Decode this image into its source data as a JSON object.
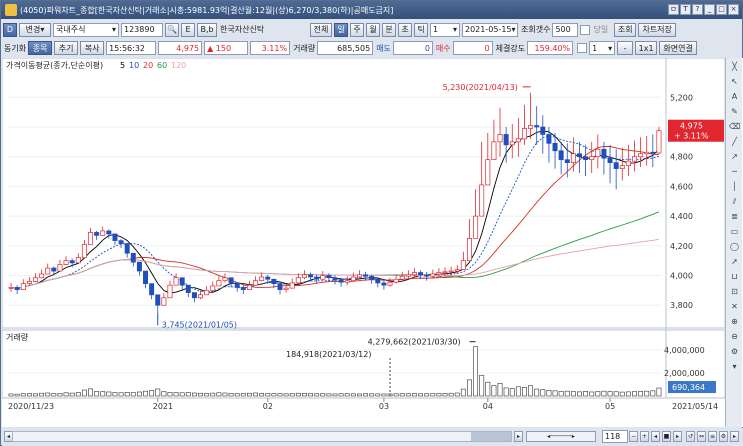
{
  "window": {
    "title": "(4050)파워차트_종합[한국자산신탁|거래소|시총:5981.93억|결산월:12월|(상)6,270/3,380(하)|공매도금지]",
    "controls": [
      "ㅁ",
      "T",
      "?",
      "_",
      "□",
      "×"
    ]
  },
  "toolbar1": {
    "left_btn": "D",
    "change_label": "변경",
    "market_select": "국내주식",
    "stock_code": "123890",
    "btn_e": "E",
    "btn_bb": "B,b",
    "stock_name": "한국자산신탁",
    "btn_all": "전체",
    "period_tabs": [
      "일",
      "주",
      "월",
      "분",
      "초",
      "틱"
    ],
    "period_count": "1",
    "date": "2021-05-15",
    "view_count_label": "조회갯수",
    "view_count": "500",
    "same_day_label": "당일",
    "query_btn": "조회",
    "save_btn": "차트저장"
  },
  "toolbar2": {
    "sync_label": "동기화",
    "item_tabs": [
      "종목",
      "추기",
      "복사"
    ],
    "time": "15:56:32",
    "price": "4,975",
    "change": "▲ 150",
    "change_pct": "3.11%",
    "volume_label": "거래량",
    "volume": "685,505",
    "sell_label": "매도",
    "sell": "0",
    "buy_label": "매수",
    "buy": "0",
    "strength_label": "체결강도",
    "strength": "159.40%",
    "sel_value": "1",
    "btn_1x1": "1x1",
    "screen_link": "화면연결"
  },
  "chart_data": [
    {
      "type": "candlestick",
      "title": "가격이동평균(종가,단순이평)",
      "ma_periods": [
        "5",
        "10",
        "20",
        "60",
        "120"
      ],
      "ma_colors": [
        "#000000",
        "#1f4fbf",
        "#d83020",
        "#2a9a4a",
        "#e8a0b0"
      ],
      "y_ticks": [
        "5,200",
        "5,000",
        "4,800",
        "4,600",
        "4,400",
        "4,200",
        "4,000",
        "3,800"
      ],
      "y_range": [
        3660,
        5330
      ],
      "high_label": "5,230(2021/04/13)",
      "low_label": "3,745(2021/01/05)",
      "current_price": "4,975",
      "current_change": "+ 3.11%",
      "closes": [
        3920,
        3905,
        3945,
        3960,
        3985,
        4010,
        4050,
        4030,
        4075,
        4100,
        4085,
        4120,
        4210,
        4290,
        4270,
        4300,
        4280,
        4235,
        4215,
        4150,
        4090,
        4030,
        3945,
        3870,
        3800,
        3850,
        3935,
        3985,
        3935,
        3885,
        3850,
        3870,
        3900,
        3930,
        3965,
        3985,
        3950,
        3920,
        3905,
        3935,
        3965,
        3990,
        3975,
        3945,
        3905,
        3915,
        3950,
        3985,
        4005,
        3990,
        3975,
        4000,
        3985,
        3970,
        3955,
        3965,
        3990,
        4005,
        3995,
        3975,
        3950,
        3935,
        3955,
        3975,
        3995,
        4005,
        4020,
        4005,
        3995,
        4010,
        4020,
        4025,
        4030,
        4040,
        4100,
        4250,
        4400,
        4610,
        4780,
        4900,
        4950,
        4880,
        4900,
        4920,
        4990,
        5010,
        5000,
        4950,
        4890,
        4840,
        4780,
        4760,
        4820,
        4800,
        4780,
        4800,
        4850,
        4790,
        4760,
        4720,
        4740,
        4770,
        4800,
        4820,
        4830,
        4825,
        4975
      ],
      "highs": [
        3950,
        3935,
        3975,
        3990,
        4015,
        4040,
        4080,
        4060,
        4105,
        4130,
        4115,
        4150,
        4240,
        4320,
        4300,
        4330,
        4310,
        4265,
        4245,
        4180,
        4120,
        4060,
        3975,
        3900,
        3830,
        3880,
        3965,
        4015,
        3965,
        3915,
        3880,
        3900,
        3930,
        3960,
        3995,
        4015,
        3980,
        3950,
        3935,
        3965,
        3995,
        4020,
        4005,
        3975,
        3935,
        3945,
        3980,
        4015,
        4035,
        4020,
        4005,
        4030,
        4015,
        4000,
        3985,
        3995,
        4020,
        4035,
        4025,
        4005,
        3980,
        3965,
        3985,
        4005,
        4025,
        4035,
        4050,
        4035,
        4025,
        4040,
        4050,
        4055,
        4060,
        4070,
        4160,
        4380,
        4580,
        4900,
        4960,
        5050,
        5130,
        5000,
        5020,
        5060,
        5150,
        5230,
        5140,
        5080,
        5000,
        4960,
        4900,
        4890,
        4930,
        4900,
        4880,
        4900,
        4950,
        4900,
        4880,
        4850,
        4860,
        4880,
        4910,
        4930,
        4940,
        4950,
        5000
      ],
      "lows": [
        3890,
        3875,
        3915,
        3930,
        3955,
        3980,
        4020,
        4000,
        4045,
        4070,
        4055,
        4090,
        4180,
        4260,
        4240,
        4270,
        4250,
        4205,
        4185,
        4120,
        4060,
        4000,
        3915,
        3840,
        3745,
        3820,
        3905,
        3955,
        3905,
        3855,
        3820,
        3840,
        3870,
        3900,
        3935,
        3955,
        3920,
        3890,
        3875,
        3905,
        3935,
        3960,
        3945,
        3915,
        3875,
        3885,
        3920,
        3955,
        3975,
        3960,
        3945,
        3970,
        3955,
        3940,
        3925,
        3935,
        3960,
        3975,
        3965,
        3945,
        3920,
        3905,
        3925,
        3945,
        3965,
        3975,
        3990,
        3975,
        3965,
        3980,
        3990,
        3995,
        4000,
        4010,
        4040,
        4120,
        4300,
        4450,
        4620,
        4780,
        4800,
        4760,
        4790,
        4800,
        4880,
        4920,
        4880,
        4820,
        4760,
        4720,
        4680,
        4660,
        4700,
        4690,
        4670,
        4690,
        4720,
        4680,
        4620,
        4580,
        4640,
        4670,
        4700,
        4730,
        4740,
        4730,
        4820
      ]
    },
    {
      "type": "bar",
      "title": "거래량",
      "y_ticks": [
        "4,000,000",
        "2,000,000"
      ],
      "y_range": [
        0,
        4600000
      ],
      "peak_label": "4,279,662(2021/03/30)",
      "marker_label": "184,918(2021/03/12)",
      "current_volume": "690,364",
      "values": [
        180000,
        160000,
        200000,
        220000,
        190000,
        240000,
        260000,
        210000,
        230000,
        280000,
        250000,
        300000,
        520000,
        620000,
        400000,
        380000,
        350000,
        300000,
        280000,
        320000,
        300000,
        350000,
        420000,
        480000,
        610000,
        380000,
        320000,
        290000,
        280000,
        300000,
        260000,
        240000,
        220000,
        250000,
        280000,
        260000,
        230000,
        210000,
        220000,
        240000,
        260000,
        230000,
        220000,
        200000,
        210000,
        190000,
        220000,
        240000,
        230000,
        210000,
        200000,
        220000,
        190000,
        180000,
        200000,
        210000,
        190000,
        180000,
        200000,
        195000,
        185000,
        175000,
        184918,
        190000,
        200000,
        210000,
        205000,
        195000,
        200000,
        210000,
        220000,
        230000,
        240000,
        260000,
        600000,
        1400000,
        4279662,
        1800000,
        1200000,
        900000,
        1100000,
        700000,
        650000,
        800000,
        750000,
        900000,
        600000,
        550000,
        500000,
        450000,
        400000,
        420000,
        380000,
        360000,
        400000,
        350000,
        380000,
        420000,
        390000,
        370000,
        340000,
        360000,
        380000,
        400000,
        420000,
        450000,
        690364
      ]
    }
  ],
  "x_axis": {
    "start": "2020/11/23",
    "ticks": [
      "2021",
      "02",
      "03",
      "04",
      "05"
    ],
    "end": "2021/05/14"
  },
  "statusbar": {
    "count": "118"
  }
}
